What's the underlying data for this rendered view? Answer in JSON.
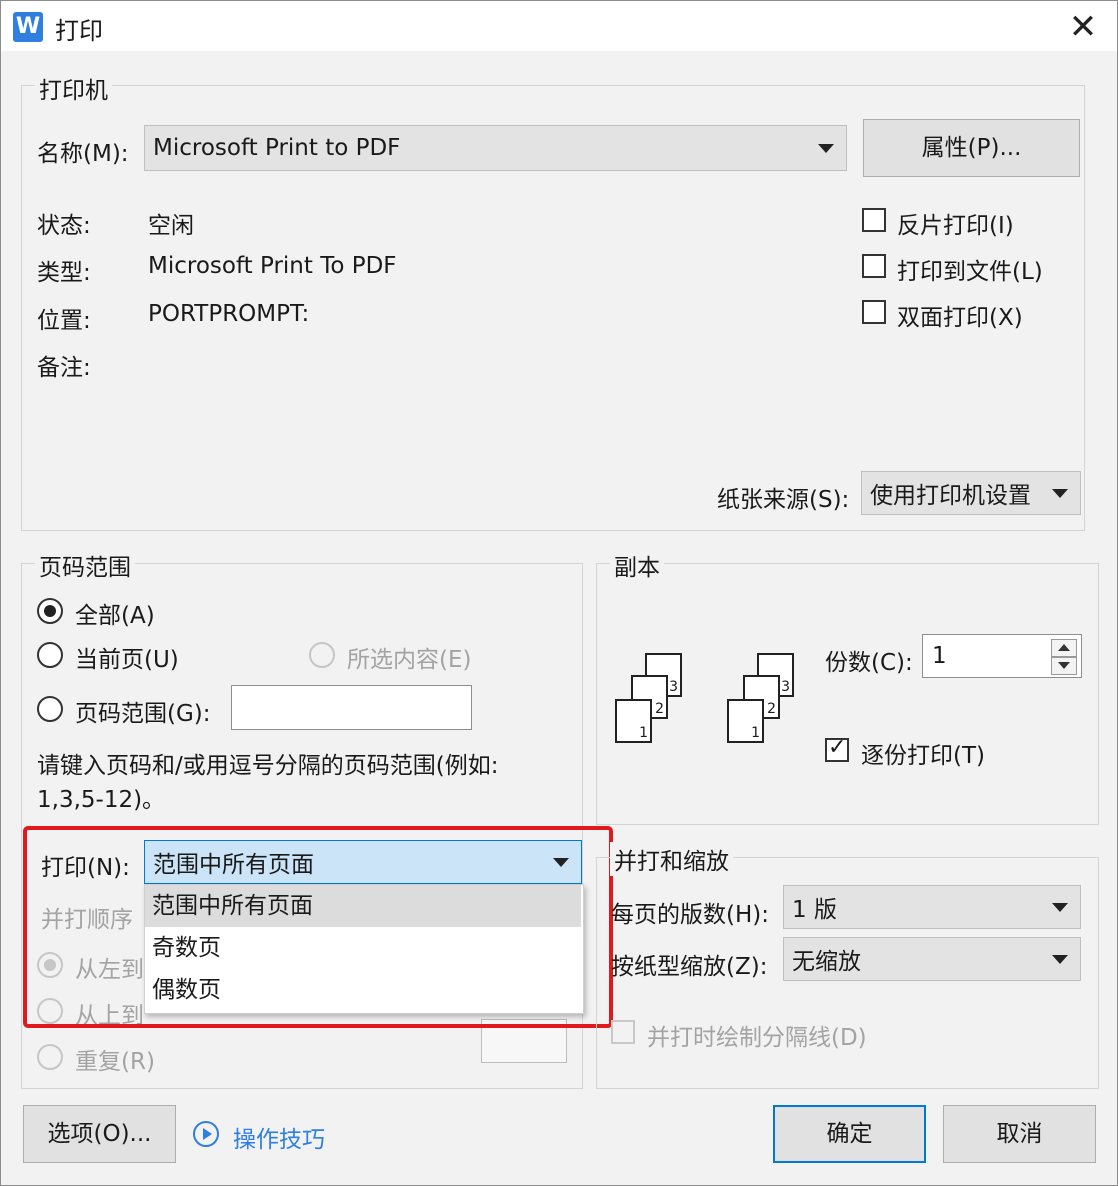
{
  "window": {
    "title": "打印",
    "app_icon": "W"
  },
  "printer": {
    "group_title": "打印机",
    "name_label": "名称(M):",
    "name_value": "Microsoft Print to PDF",
    "properties_button": "属性(P)...",
    "status_label": "状态:",
    "status_value": "空闲",
    "type_label": "类型:",
    "type_value": "Microsoft Print To PDF",
    "location_label": "位置:",
    "location_value": "PORTPROMPT:",
    "comment_label": "备注:",
    "reverse_print": {
      "label": "反片打印(I)",
      "checked": false
    },
    "print_to_file": {
      "label": "打印到文件(L)",
      "checked": false
    },
    "duplex": {
      "label": "双面打印(X)",
      "checked": false
    },
    "paper_source_label": "纸张来源(S):",
    "paper_source_value": "使用打印机设置"
  },
  "page_range": {
    "group_title": "页码范围",
    "all": "全部(A)",
    "current": "当前页(U)",
    "selection": "所选内容(E)",
    "range": "页码范围(G):",
    "range_value": "",
    "hint_line1": "请键入页码和/或用逗号分隔的页码范围(例如:",
    "hint_line2": "1,3,5-12)。",
    "print_label": "打印(N):",
    "print_value": "范围中所有页面",
    "print_options": [
      "范围中所有页面",
      "奇数页",
      "偶数页"
    ],
    "order_title": "并打顺序",
    "order_ltr": "从左到",
    "order_ttb": "从上到",
    "repeat": "重复(R)"
  },
  "copies": {
    "group_title": "副本",
    "count_label": "份数(C):",
    "count_value": "1",
    "collate": {
      "label": "逐份打印(T)",
      "checked": true
    },
    "page_numbers": [
      "1",
      "2",
      "3"
    ]
  },
  "scaling": {
    "group_title": "并打和缩放",
    "pages_per_sheet_label": "每页的版数(H):",
    "pages_per_sheet_value": "1 版",
    "scale_label": "按纸型缩放(Z):",
    "scale_value": "无缩放",
    "draw_lines": {
      "label": "并打时绘制分隔线(D)",
      "checked": false
    }
  },
  "footer": {
    "options_button": "选项(O)...",
    "tips_link": "操作技巧",
    "ok_button": "确定",
    "cancel_button": "取消"
  },
  "colors": {
    "accent": "#2f7fe0",
    "highlight": "#e0191e",
    "selected": "#cce4f7"
  }
}
